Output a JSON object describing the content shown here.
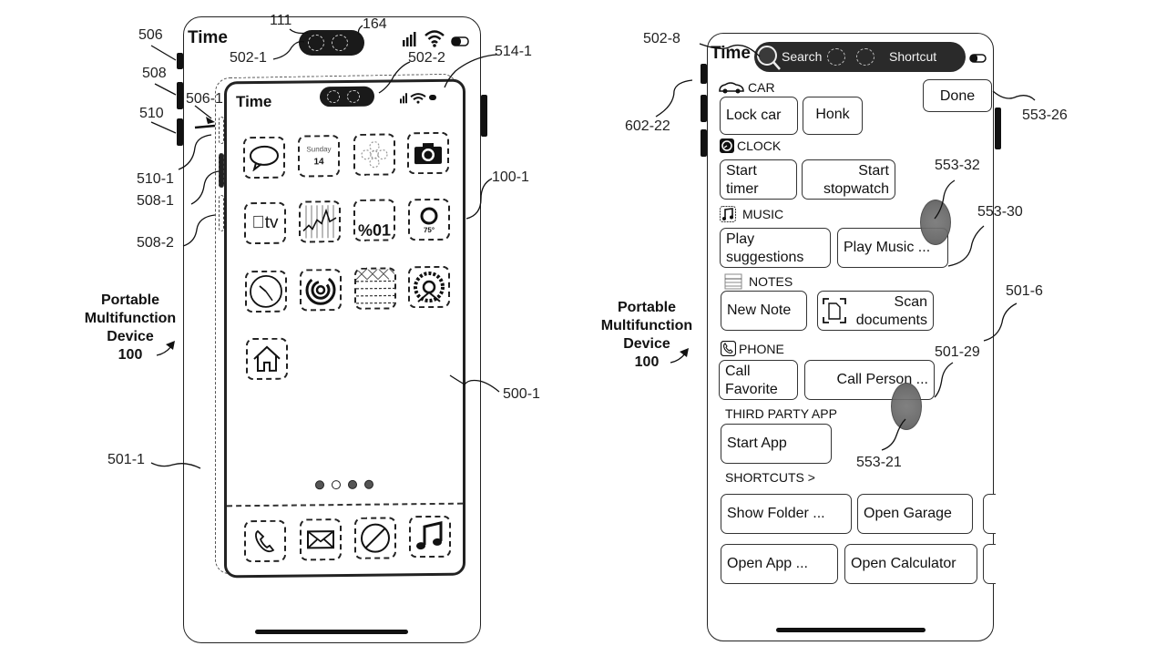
{
  "figure": {
    "caption_left": [
      "Portable",
      "Multifunction",
      "Device",
      "100"
    ],
    "caption_right": [
      "Portable",
      "Multifunction",
      "Device",
      "100"
    ]
  },
  "left_device": {
    "status_time": "Time",
    "inner_status_time": "Time",
    "refs": {
      "r111": "111",
      "r164": "164",
      "r506": "506",
      "r508": "508",
      "r510": "510",
      "r502_1": "502-1",
      "r502_2": "502-2",
      "r514_1": "514-1",
      "r506_1": "506-1",
      "r510_1": "510-1",
      "r508_1": "508-1",
      "r508_2": "508-2",
      "r100_1": "100-1",
      "r500_1": "500-1",
      "r501_1": "501-1"
    },
    "apps": [
      {
        "name": "messages-icon"
      },
      {
        "name": "calendar-icon",
        "day": "Sunday",
        "date": "14"
      },
      {
        "name": "photos-icon"
      },
      {
        "name": "camera-icon"
      },
      {
        "name": "tv-icon",
        "label": "tv"
      },
      {
        "name": "stocks-icon"
      },
      {
        "name": "wallet-icon",
        "label": "%01"
      },
      {
        "name": "weather-icon",
        "label": "75°"
      },
      {
        "name": "clock-icon"
      },
      {
        "name": "fitness-icon"
      },
      {
        "name": "notes-icon"
      },
      {
        "name": "settings-icon"
      },
      {
        "name": "home-icon"
      }
    ],
    "dock": [
      {
        "name": "phone-icon"
      },
      {
        "name": "mail-icon"
      },
      {
        "name": "safari-icon"
      },
      {
        "name": "music-icon"
      }
    ],
    "page_dots": {
      "count": 4,
      "current": 2
    }
  },
  "right_device": {
    "status_time": "Time",
    "pill": {
      "search_label": "Search",
      "shortcut_label": "Shortcut"
    },
    "done_label": "Done",
    "sections": {
      "car": "CAR",
      "clock": "CLOCK",
      "music": "MUSIC",
      "notes": "NOTES",
      "phone": "PHONE",
      "third_party": "THIRD PARTY APP",
      "shortcuts": "SHORTCUTS >"
    },
    "buttons": {
      "lock_car": "Lock car",
      "honk": "Honk",
      "start_timer": [
        "Start",
        "timer"
      ],
      "start_stopwatch": [
        "Start",
        "stopwatch"
      ],
      "play_suggestions": [
        "Play",
        "suggestions"
      ],
      "play_music": "Play Music ...",
      "new_note": "New Note",
      "scan_documents": [
        "Scan",
        "documents"
      ],
      "call_favorite": [
        "Call",
        "Favorite"
      ],
      "call_person": "Call Person ...",
      "start_app": "Start App",
      "show_folder": "Show Folder ...",
      "open_garage": "Open Garage",
      "open_app": "Open App ...",
      "open_calculator": "Open Calculator"
    },
    "refs": {
      "r502_8": "502-8",
      "r602_22": "602-22",
      "r553_26": "553-26",
      "r553_32": "553-32",
      "r553_30": "553-30",
      "r501_6": "501-6",
      "r501_29": "501-29",
      "r553_21": "553-21"
    }
  }
}
